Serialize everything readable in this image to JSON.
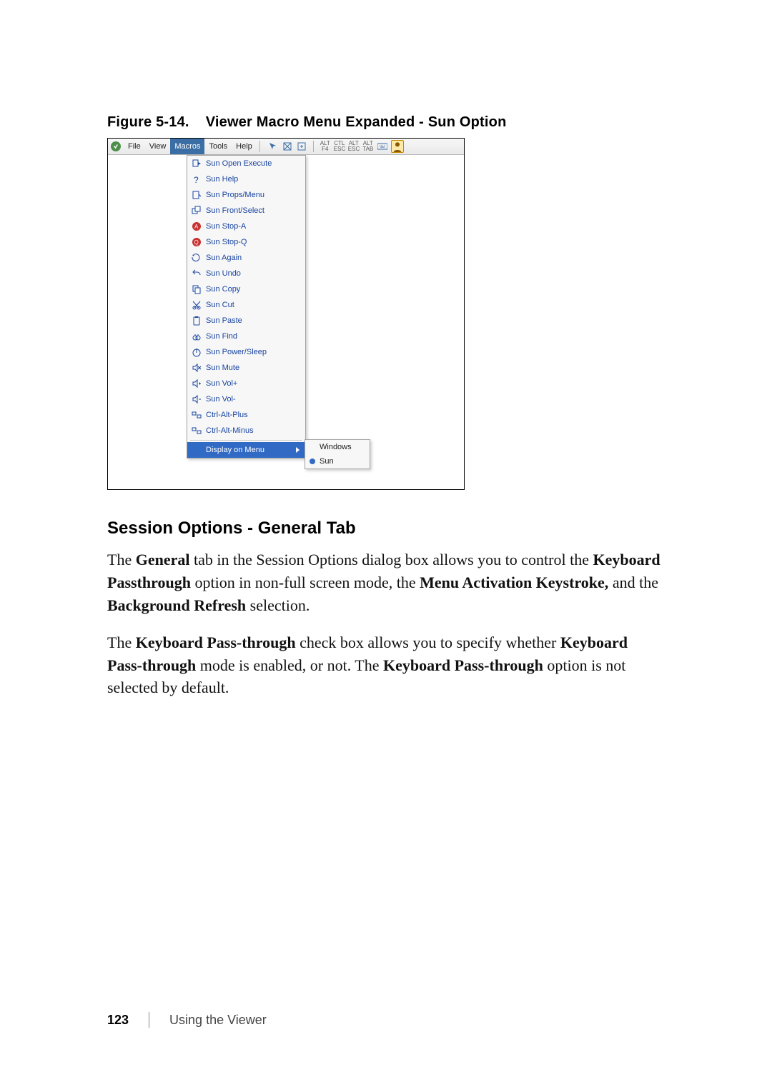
{
  "figure": {
    "label": "Figure 5-14.",
    "title": "Viewer Macro Menu Expanded - Sun Option"
  },
  "menubar": {
    "items": [
      "File",
      "View",
      "Macros",
      "Tools",
      "Help"
    ],
    "active_index": 2,
    "toolbar_tags": [
      "ALT F4",
      "CTL ESC",
      "ALT ESC",
      "ALT TAB"
    ]
  },
  "macro_menu": {
    "items": [
      {
        "icon": "execute-icon",
        "label": "Sun Open Execute"
      },
      {
        "icon": "help-icon",
        "label": "Sun Help"
      },
      {
        "icon": "props-icon",
        "label": "Sun Props/Menu"
      },
      {
        "icon": "front-icon",
        "label": "Sun Front/Select"
      },
      {
        "icon": "stop-a-icon",
        "label": "Sun Stop-A"
      },
      {
        "icon": "stop-q-icon",
        "label": "Sun Stop-Q"
      },
      {
        "icon": "again-icon",
        "label": "Sun Again"
      },
      {
        "icon": "undo-icon",
        "label": "Sun Undo"
      },
      {
        "icon": "copy-icon",
        "label": "Sun Copy"
      },
      {
        "icon": "cut-icon",
        "label": "Sun Cut"
      },
      {
        "icon": "paste-icon",
        "label": "Sun Paste"
      },
      {
        "icon": "find-icon",
        "label": "Sun Find"
      },
      {
        "icon": "power-icon",
        "label": "Sun Power/Sleep"
      },
      {
        "icon": "mute-icon",
        "label": "Sun Mute"
      },
      {
        "icon": "volup-icon",
        "label": "Sun Vol+"
      },
      {
        "icon": "voldown-icon",
        "label": "Sun Vol-"
      },
      {
        "icon": "ctrl-alt-icon",
        "label": "Ctrl-Alt-Plus"
      },
      {
        "icon": "ctrl-alt-icon",
        "label": "Ctrl-Alt-Minus"
      }
    ],
    "footer_item": {
      "label": "Display on Menu"
    }
  },
  "submenu": {
    "items": [
      {
        "label": "Windows",
        "selected": false
      },
      {
        "label": "Sun",
        "selected": true
      }
    ]
  },
  "section": {
    "heading": "Session Options - General Tab"
  },
  "para1": {
    "t0": "The ",
    "b0": "General",
    "t1": " tab in the Session Options dialog box allows you to control the ",
    "b1": "Keyboard Passthrough",
    "t2": " option in non-full screen mode, the ",
    "b2": "Menu Activation Keystroke,",
    "t3": " and the ",
    "b3": "Background Refresh",
    "t4": " selection."
  },
  "para2": {
    "t0": "The ",
    "b0": "Keyboard Pass-through",
    "t1": " check box allows you to specify whether ",
    "b1": "Keyboard Pass-through",
    "t2": " mode is enabled, or not. The ",
    "b2": "Keyboard Pass-through",
    "t3": " option is not selected by default."
  },
  "footer": {
    "page": "123",
    "section": "Using the Viewer"
  },
  "colors": {
    "link": "#1844a0",
    "highlight": "#316ac5"
  }
}
